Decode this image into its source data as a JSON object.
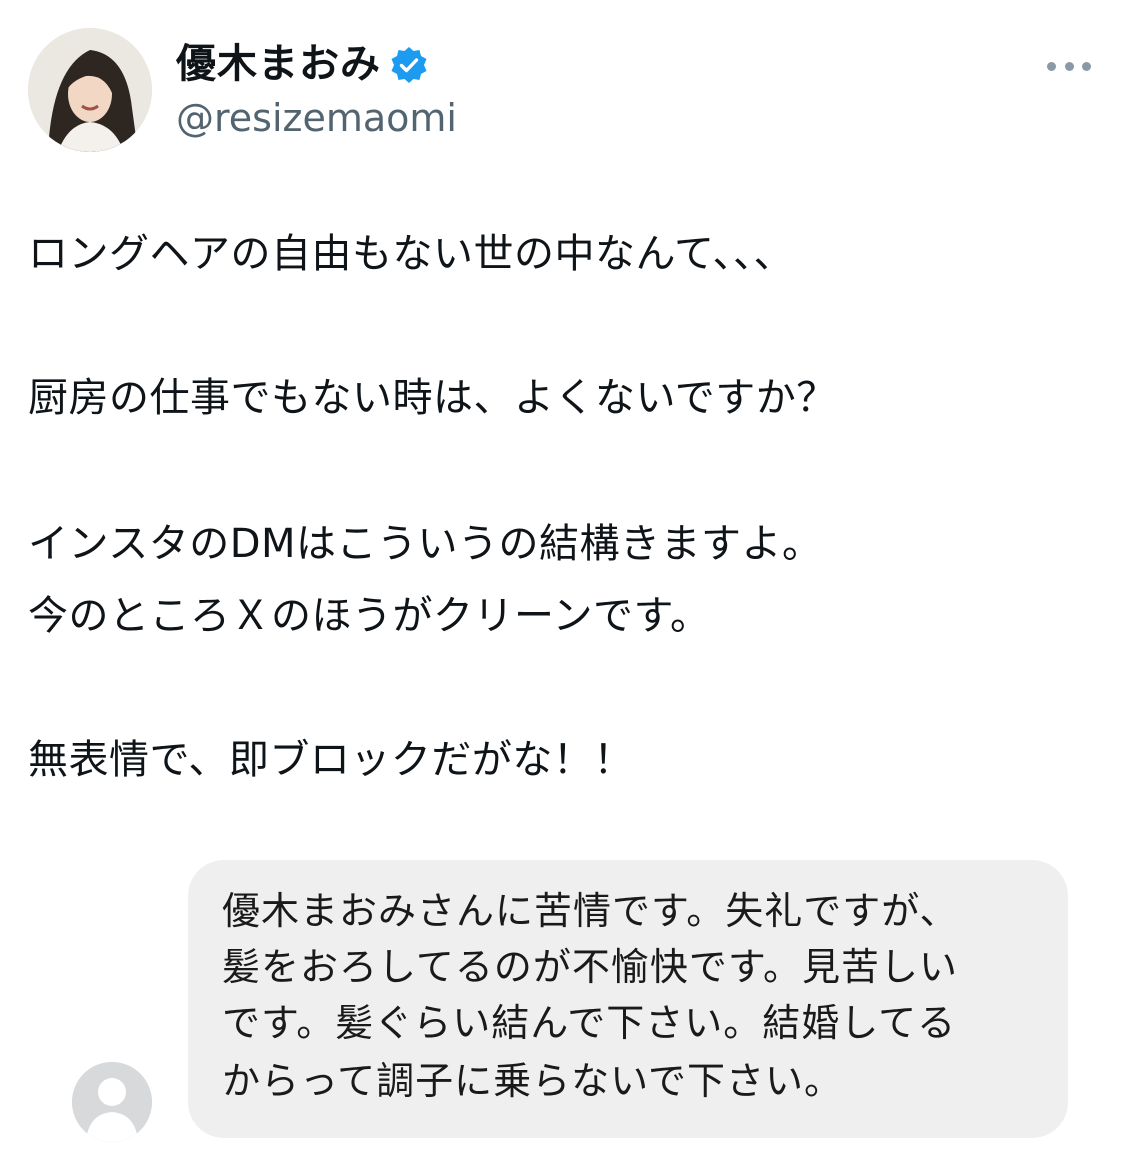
{
  "profile": {
    "display_name": "優木まおみ",
    "handle": "@resizemaomi",
    "verified_icon": "verified-badge-icon",
    "more_icon": "more-options-icon"
  },
  "tweet": {
    "lines": [
      "ロングヘアの自由もない世の中なんて、、、",
      "厨房の仕事でもない時は、よくないですか？",
      "インスタのDMはこういうの結構きますよ。",
      "今のところＸのほうがクリーンです。",
      "無表情で、即ブロックだがな！！"
    ]
  },
  "dm": {
    "avatar_icon": "default-user-icon",
    "lines": [
      "優木まおみさんに苦情です。失礼ですが、",
      "髪をおろしてるのが不愉快です。見苦しい",
      "です。髪ぐらい結んで下さい。結婚してる",
      "からって調子に乗らないで下さい。"
    ]
  },
  "colors": {
    "verified": "#1d9bf0",
    "secondary_text": "#536471",
    "bubble": "#efefef"
  }
}
